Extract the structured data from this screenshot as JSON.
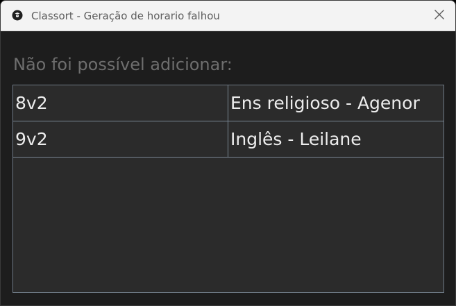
{
  "window": {
    "title": "Classort - Geração de horario falhou",
    "icon": "classort-logo-icon",
    "close_icon": "close-icon"
  },
  "dialog": {
    "heading": "Não foi possível adicionar:",
    "rows": [
      {
        "class": "8v2",
        "subject": "Ens religioso - Agenor"
      },
      {
        "class": "9v2",
        "subject": "Inglês - Leilane"
      }
    ]
  },
  "colors": {
    "titlebar_bg": "#f3f3f3",
    "content_bg": "#1d1d1d",
    "table_bg": "#2b2b2b",
    "grid_line": "#7a8794",
    "cell_text": "#ededed",
    "heading_text": "#6e6e6e"
  }
}
